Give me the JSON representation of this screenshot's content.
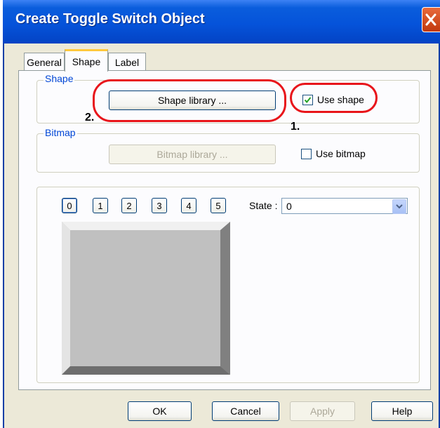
{
  "window": {
    "title": "Create Toggle Switch Object"
  },
  "tabs": [
    {
      "label": "General",
      "active": false
    },
    {
      "label": "Shape",
      "active": true
    },
    {
      "label": "Label",
      "active": false
    }
  ],
  "shape_group": {
    "label": "Shape",
    "library_button": "Shape  library ...",
    "use_shape_label": "Use shape",
    "use_shape_checked": true
  },
  "bitmap_group": {
    "label": "Bitmap",
    "library_button": "Bitmap  library ...",
    "use_bitmap_label": "Use bitmap",
    "use_bitmap_checked": false
  },
  "annotations": {
    "step1": "1.",
    "step2": "2.",
    "color": "#e8151b"
  },
  "states": {
    "buttons": [
      "0",
      "1",
      "2",
      "3",
      "4",
      "5"
    ],
    "selected": "0",
    "label": "State :",
    "value": "0"
  },
  "footer": {
    "ok": "OK",
    "cancel": "Cancel",
    "apply": "Apply",
    "help": "Help"
  },
  "colors": {
    "title_bar": "#0553da",
    "dialog_bg": "#ece9d8",
    "group_label": "#0046d5",
    "active_tab_accent": "#ffc83c",
    "preview_fill": "#c0c0c0"
  }
}
